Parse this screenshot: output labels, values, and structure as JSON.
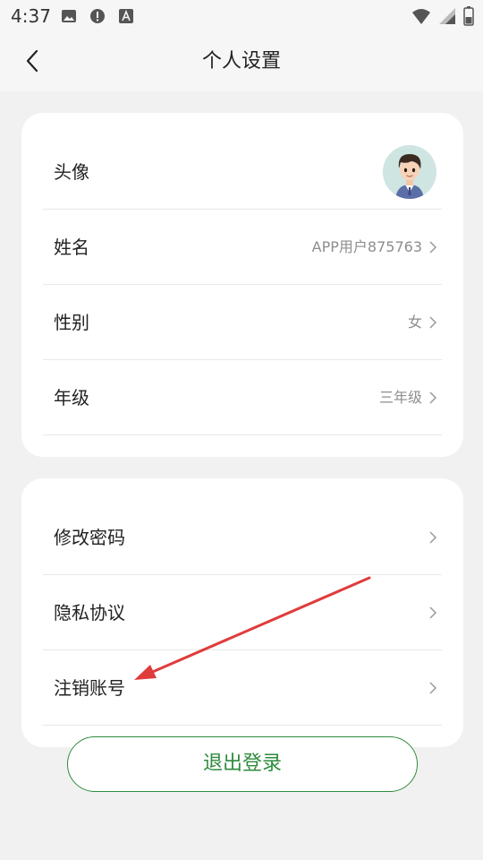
{
  "status_bar": {
    "time": "4:37",
    "icons": [
      "image-icon",
      "alert-icon",
      "font-icon",
      "wifi-icon",
      "signal-icon",
      "battery-icon"
    ]
  },
  "app_bar": {
    "title": "个人设置",
    "back_icon": "chevron-left-icon"
  },
  "profile_card": {
    "rows": [
      {
        "label": "头像",
        "value": "",
        "icon": "avatar"
      },
      {
        "label": "姓名",
        "value": "APP用户875763"
      },
      {
        "label": "性别",
        "value": "女"
      },
      {
        "label": "年级",
        "value": "三年级"
      }
    ]
  },
  "security_card": {
    "rows": [
      {
        "label": "修改密码"
      },
      {
        "label": "隐私协议"
      },
      {
        "label": "注销账号"
      }
    ]
  },
  "logout": {
    "label": "退出登录"
  },
  "colors": {
    "accent": "#2e8b3d",
    "annotation": "#e03c3c",
    "background": "#f1f1f1"
  }
}
